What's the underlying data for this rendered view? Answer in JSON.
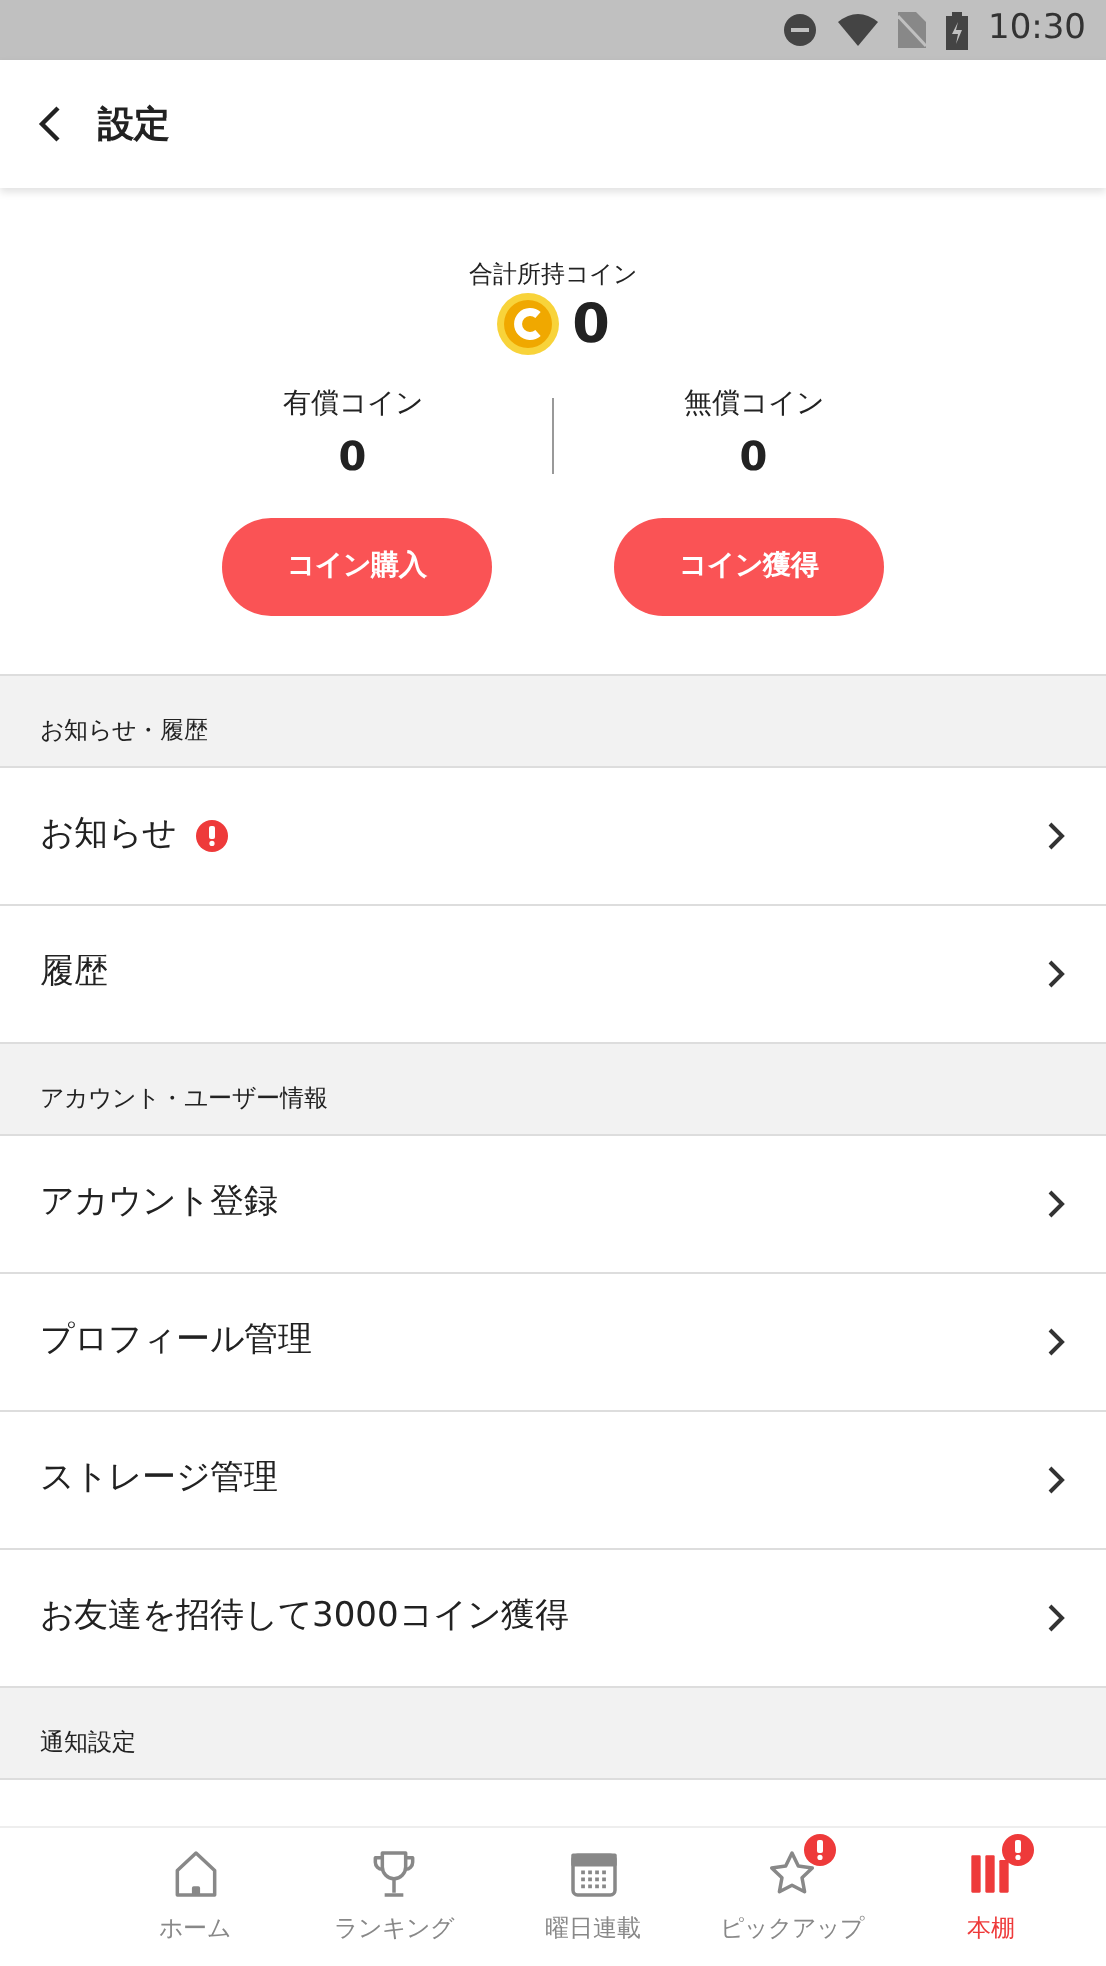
{
  "status_bar": {
    "time": "10:30"
  },
  "header": {
    "title": "設定"
  },
  "coins": {
    "total_label": "合計所持コイン",
    "total": "0",
    "paid_label": "有償コイン",
    "paid": "0",
    "free_label": "無償コイン",
    "free": "0",
    "buttons": [
      "コイン購入",
      "コイン獲得"
    ]
  },
  "sections": [
    {
      "title": "お知らせ・履歴",
      "items": [
        {
          "label": "お知らせ",
          "alert": true
        },
        {
          "label": "履歴",
          "alert": false
        }
      ]
    },
    {
      "title": "アカウント・ユーザー情報",
      "items": [
        {
          "label": "アカウント登録",
          "alert": false
        },
        {
          "label": "プロフィール管理",
          "alert": false
        },
        {
          "label": "ストレージ管理",
          "alert": false
        },
        {
          "label": "お友達を招待して3000コイン獲得",
          "alert": false
        }
      ]
    },
    {
      "title": "通知設定"
    }
  ],
  "tabs": [
    {
      "kind": "home",
      "label": "ホーム",
      "selected": false,
      "alert": false
    },
    {
      "kind": "trophy",
      "label": "ランキング",
      "selected": false,
      "alert": false
    },
    {
      "kind": "calendar",
      "label": "曜日連載",
      "selected": false,
      "alert": false
    },
    {
      "kind": "star",
      "label": "ピックアップ",
      "selected": false,
      "alert": true
    },
    {
      "kind": "books",
      "label": "本棚",
      "selected": true,
      "alert": true
    }
  ]
}
